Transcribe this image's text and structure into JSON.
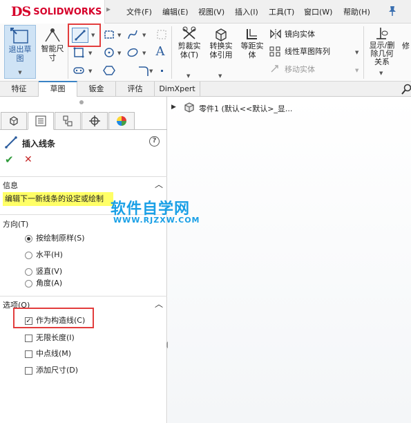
{
  "app": {
    "logo_prefix": "DS",
    "logo_name": "SOLIDWORKS"
  },
  "menu": [
    "文件(F)",
    "编辑(E)",
    "视图(V)",
    "插入(I)",
    "工具(T)",
    "窗口(W)",
    "帮助(H)"
  ],
  "ribbon": {
    "exit_sketch": "退出草\n图",
    "smart_dim": "智能尺\n寸",
    "trim": "剪裁实\n体(T)",
    "convert": "转换实\n体引用",
    "offset": "等距实\n体",
    "mirror": "镜向实体",
    "linear_pattern": "线性草图阵列",
    "move": "移动实体",
    "display_relations": "显示/删\n除几何\n关系",
    "repair": "修"
  },
  "tabs": [
    "特征",
    "草图",
    "钣金",
    "评估",
    "DimXpert"
  ],
  "active_tab": "草图",
  "tree": {
    "part_label": "零件1  (默认<<默认>_显..."
  },
  "panel": {
    "title": "插入线条",
    "info_header": "信息",
    "info_text": "编辑下一新线条的设定或绘制",
    "direction_header": "方向(T)",
    "directions": [
      {
        "label": "按绘制原样(S)",
        "selected": true
      },
      {
        "label": "水平(H)",
        "selected": false
      },
      {
        "label": "竖直(V)",
        "selected": false
      },
      {
        "label": "角度(A)",
        "selected": false
      }
    ],
    "options_header": "选项(O)",
    "options": [
      {
        "label": "作为构造线(C)",
        "checked": true
      },
      {
        "label": "无限长度(I)",
        "checked": false
      },
      {
        "label": "中点线(M)",
        "checked": false
      },
      {
        "label": "添加尺寸(D)",
        "checked": false
      }
    ]
  },
  "watermark": {
    "title": "软件自学网",
    "url": "WWW.RJZXW.COM"
  },
  "colors": {
    "brand": "#d6002a",
    "highlight": "#ffff66",
    "accent": "#3a83c5",
    "watermark": "#1aa0e6",
    "redbox": "#e23c3c"
  }
}
